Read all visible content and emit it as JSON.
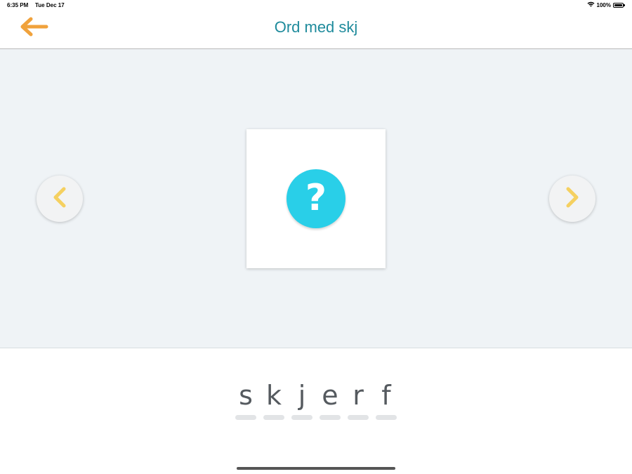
{
  "status_bar": {
    "time": "6:35 PM",
    "date": "Tue Dec 17",
    "battery": "100%",
    "icons": [
      "wifi-icon",
      "battery-icon"
    ]
  },
  "header": {
    "title": "Ord med skj",
    "back_icon": "arrow-left-icon"
  },
  "colors": {
    "title": "#1f8b9c",
    "back_arrow": "#f0a23c",
    "nav_chevron": "#f5d060",
    "help_button": "#29cfe8",
    "stage_background": "#eff3f6",
    "letters": "#555a5f"
  },
  "card": {
    "help_symbol": "?",
    "icon": "question-mark-icon"
  },
  "nav": {
    "prev_icon": "chevron-left-icon",
    "next_icon": "chevron-right-icon"
  },
  "word": {
    "letters": [
      "s",
      "k",
      "j",
      "e",
      "r",
      "f"
    ]
  }
}
